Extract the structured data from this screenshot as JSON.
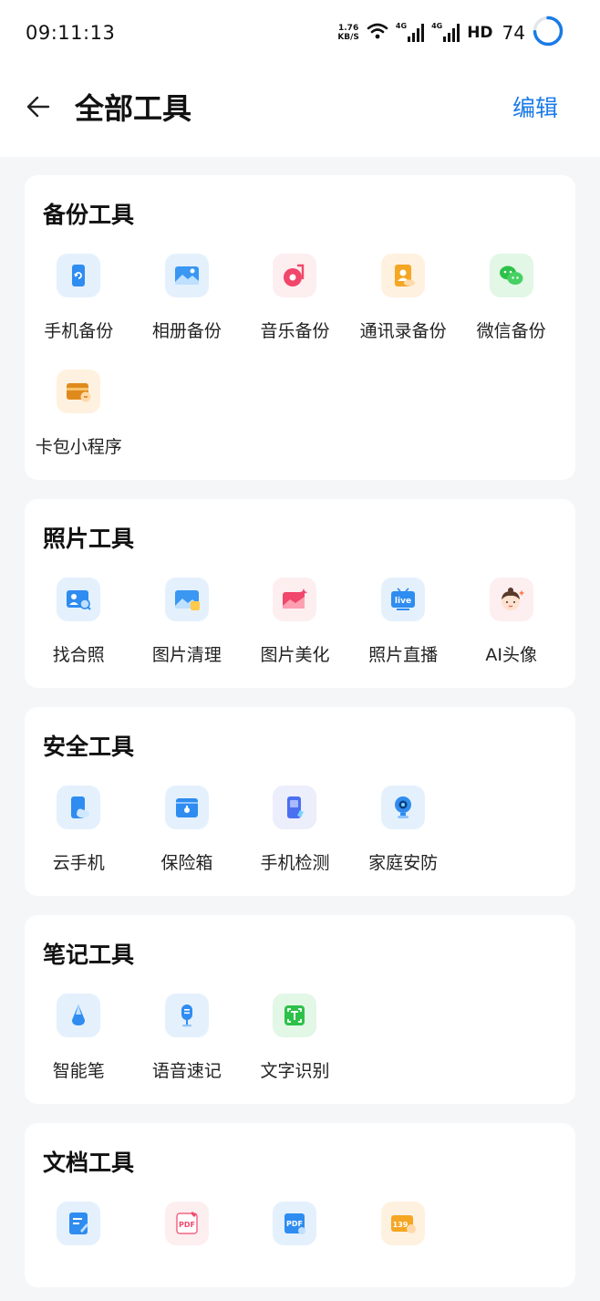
{
  "status": {
    "time": "09:11:13",
    "speed_value": "1.76",
    "speed_unit": "KB/S",
    "signal1_label": "4G",
    "signal2_label": "4G",
    "hd_label": "HD",
    "battery": "74"
  },
  "header": {
    "title": "全部工具",
    "edit_label": "编辑"
  },
  "sections": [
    {
      "title": "备份工具",
      "items": [
        {
          "label": "手机备份",
          "icon": "phone-backup-icon"
        },
        {
          "label": "相册备份",
          "icon": "album-backup-icon"
        },
        {
          "label": "音乐备份",
          "icon": "music-backup-icon"
        },
        {
          "label": "通讯录备份",
          "icon": "contacts-backup-icon"
        },
        {
          "label": "微信备份",
          "icon": "wechat-backup-icon"
        },
        {
          "label": "卡包小程序",
          "icon": "card-wallet-icon"
        }
      ]
    },
    {
      "title": "照片工具",
      "items": [
        {
          "label": "找合照",
          "icon": "group-photo-icon"
        },
        {
          "label": "图片清理",
          "icon": "photo-clean-icon"
        },
        {
          "label": "图片美化",
          "icon": "photo-beautify-icon"
        },
        {
          "label": "照片直播",
          "icon": "photo-live-icon"
        },
        {
          "label": "AI头像",
          "icon": "ai-avatar-icon"
        }
      ]
    },
    {
      "title": "安全工具",
      "items": [
        {
          "label": "云手机",
          "icon": "cloud-phone-icon"
        },
        {
          "label": "保险箱",
          "icon": "safe-box-icon"
        },
        {
          "label": "手机检测",
          "icon": "phone-check-icon"
        },
        {
          "label": "家庭安防",
          "icon": "home-camera-icon"
        }
      ]
    },
    {
      "title": "笔记工具",
      "items": [
        {
          "label": "智能笔",
          "icon": "smart-pen-icon"
        },
        {
          "label": "语音速记",
          "icon": "voice-note-icon"
        },
        {
          "label": "文字识别",
          "icon": "text-ocr-icon"
        }
      ]
    },
    {
      "title": "文档工具",
      "items": [
        {
          "icon": "doc-edit-icon"
        },
        {
          "icon": "pdf-tool-icon"
        },
        {
          "icon": "pdf-convert-icon"
        },
        {
          "icon": "mail-139-icon"
        }
      ]
    }
  ]
}
